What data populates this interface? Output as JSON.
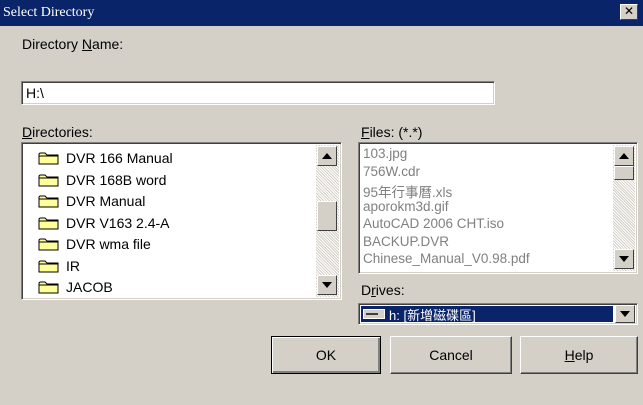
{
  "window": {
    "title": "Select Directory"
  },
  "directory_name": {
    "label_before": "Directory ",
    "label_access": "N",
    "label_after": "ame:",
    "value": "H:\\"
  },
  "directories": {
    "label_access": "D",
    "label_rest": "irectories:",
    "items": [
      {
        "name": "DVR 166 Manual",
        "icon": "folder-icon"
      },
      {
        "name": "DVR 168B word",
        "icon": "folder-icon"
      },
      {
        "name": "DVR Manual",
        "icon": "folder-icon"
      },
      {
        "name": "DVR V163 2.4-A",
        "icon": "folder-icon"
      },
      {
        "name": "DVR wma file",
        "icon": "folder-icon"
      },
      {
        "name": "IR",
        "icon": "folder-icon"
      },
      {
        "name": "JACOB",
        "icon": "folder-icon"
      }
    ]
  },
  "files": {
    "label_access": "F",
    "label_rest": "iles: (*.*)",
    "items": [
      "103.jpg",
      "756W.cdr",
      "95年行事曆.xls",
      "aporokm3d.gif",
      "AutoCAD 2006 CHT.iso",
      "BACKUP.DVR",
      "Chinese_Manual_V0.98.pdf"
    ]
  },
  "drives": {
    "label_before": "D",
    "label_access": "r",
    "label_after": "ives:",
    "selected": "h: [新增磁碟區]",
    "icon": "drive-icon"
  },
  "buttons": {
    "ok": "OK",
    "cancel": "Cancel",
    "help_access": "H",
    "help_rest": "elp"
  },
  "colors": {
    "face": "#d4d0c8",
    "titlebar": "#0a246a",
    "selection": "#0a246a"
  }
}
